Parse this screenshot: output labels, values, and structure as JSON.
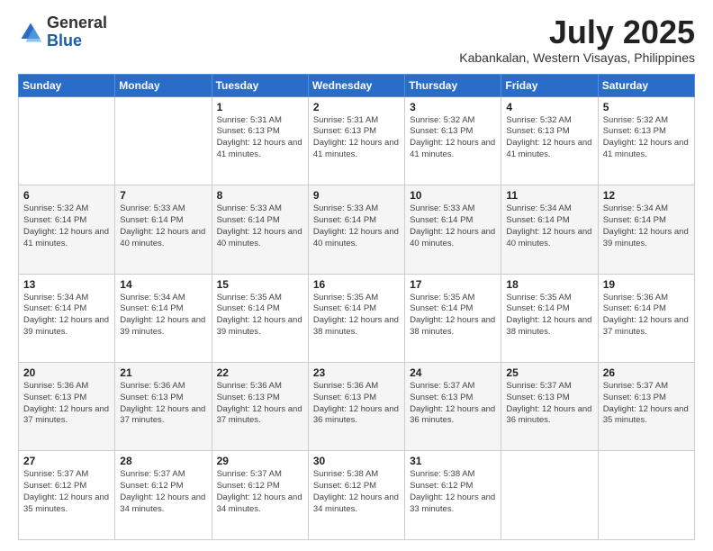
{
  "logo": {
    "general": "General",
    "blue": "Blue"
  },
  "title": "July 2025",
  "subtitle": "Kabankalan, Western Visayas, Philippines",
  "days_of_week": [
    "Sunday",
    "Monday",
    "Tuesday",
    "Wednesday",
    "Thursday",
    "Friday",
    "Saturday"
  ],
  "weeks": [
    [
      {
        "day": "",
        "info": ""
      },
      {
        "day": "",
        "info": ""
      },
      {
        "day": "1",
        "info": "Sunrise: 5:31 AM\nSunset: 6:13 PM\nDaylight: 12 hours and 41 minutes."
      },
      {
        "day": "2",
        "info": "Sunrise: 5:31 AM\nSunset: 6:13 PM\nDaylight: 12 hours and 41 minutes."
      },
      {
        "day": "3",
        "info": "Sunrise: 5:32 AM\nSunset: 6:13 PM\nDaylight: 12 hours and 41 minutes."
      },
      {
        "day": "4",
        "info": "Sunrise: 5:32 AM\nSunset: 6:13 PM\nDaylight: 12 hours and 41 minutes."
      },
      {
        "day": "5",
        "info": "Sunrise: 5:32 AM\nSunset: 6:13 PM\nDaylight: 12 hours and 41 minutes."
      }
    ],
    [
      {
        "day": "6",
        "info": "Sunrise: 5:32 AM\nSunset: 6:14 PM\nDaylight: 12 hours and 41 minutes."
      },
      {
        "day": "7",
        "info": "Sunrise: 5:33 AM\nSunset: 6:14 PM\nDaylight: 12 hours and 40 minutes."
      },
      {
        "day": "8",
        "info": "Sunrise: 5:33 AM\nSunset: 6:14 PM\nDaylight: 12 hours and 40 minutes."
      },
      {
        "day": "9",
        "info": "Sunrise: 5:33 AM\nSunset: 6:14 PM\nDaylight: 12 hours and 40 minutes."
      },
      {
        "day": "10",
        "info": "Sunrise: 5:33 AM\nSunset: 6:14 PM\nDaylight: 12 hours and 40 minutes."
      },
      {
        "day": "11",
        "info": "Sunrise: 5:34 AM\nSunset: 6:14 PM\nDaylight: 12 hours and 40 minutes."
      },
      {
        "day": "12",
        "info": "Sunrise: 5:34 AM\nSunset: 6:14 PM\nDaylight: 12 hours and 39 minutes."
      }
    ],
    [
      {
        "day": "13",
        "info": "Sunrise: 5:34 AM\nSunset: 6:14 PM\nDaylight: 12 hours and 39 minutes."
      },
      {
        "day": "14",
        "info": "Sunrise: 5:34 AM\nSunset: 6:14 PM\nDaylight: 12 hours and 39 minutes."
      },
      {
        "day": "15",
        "info": "Sunrise: 5:35 AM\nSunset: 6:14 PM\nDaylight: 12 hours and 39 minutes."
      },
      {
        "day": "16",
        "info": "Sunrise: 5:35 AM\nSunset: 6:14 PM\nDaylight: 12 hours and 38 minutes."
      },
      {
        "day": "17",
        "info": "Sunrise: 5:35 AM\nSunset: 6:14 PM\nDaylight: 12 hours and 38 minutes."
      },
      {
        "day": "18",
        "info": "Sunrise: 5:35 AM\nSunset: 6:14 PM\nDaylight: 12 hours and 38 minutes."
      },
      {
        "day": "19",
        "info": "Sunrise: 5:36 AM\nSunset: 6:14 PM\nDaylight: 12 hours and 37 minutes."
      }
    ],
    [
      {
        "day": "20",
        "info": "Sunrise: 5:36 AM\nSunset: 6:13 PM\nDaylight: 12 hours and 37 minutes."
      },
      {
        "day": "21",
        "info": "Sunrise: 5:36 AM\nSunset: 6:13 PM\nDaylight: 12 hours and 37 minutes."
      },
      {
        "day": "22",
        "info": "Sunrise: 5:36 AM\nSunset: 6:13 PM\nDaylight: 12 hours and 37 minutes."
      },
      {
        "day": "23",
        "info": "Sunrise: 5:36 AM\nSunset: 6:13 PM\nDaylight: 12 hours and 36 minutes."
      },
      {
        "day": "24",
        "info": "Sunrise: 5:37 AM\nSunset: 6:13 PM\nDaylight: 12 hours and 36 minutes."
      },
      {
        "day": "25",
        "info": "Sunrise: 5:37 AM\nSunset: 6:13 PM\nDaylight: 12 hours and 36 minutes."
      },
      {
        "day": "26",
        "info": "Sunrise: 5:37 AM\nSunset: 6:13 PM\nDaylight: 12 hours and 35 minutes."
      }
    ],
    [
      {
        "day": "27",
        "info": "Sunrise: 5:37 AM\nSunset: 6:12 PM\nDaylight: 12 hours and 35 minutes."
      },
      {
        "day": "28",
        "info": "Sunrise: 5:37 AM\nSunset: 6:12 PM\nDaylight: 12 hours and 34 minutes."
      },
      {
        "day": "29",
        "info": "Sunrise: 5:37 AM\nSunset: 6:12 PM\nDaylight: 12 hours and 34 minutes."
      },
      {
        "day": "30",
        "info": "Sunrise: 5:38 AM\nSunset: 6:12 PM\nDaylight: 12 hours and 34 minutes."
      },
      {
        "day": "31",
        "info": "Sunrise: 5:38 AM\nSunset: 6:12 PM\nDaylight: 12 hours and 33 minutes."
      },
      {
        "day": "",
        "info": ""
      },
      {
        "day": "",
        "info": ""
      }
    ]
  ]
}
